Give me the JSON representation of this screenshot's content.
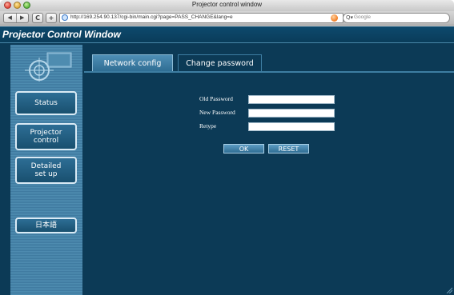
{
  "window": {
    "title": "Projector control window"
  },
  "toolbar": {
    "back_icon": "back-arrow-icon",
    "forward_icon": "forward-arrow-icon",
    "reload_label": "C",
    "add_label": "+",
    "url": "http://169.254.90.137/cgi-bin/main.cgi?page=PASS_CHANGE&lang=e",
    "search_placeholder": "Google"
  },
  "app": {
    "title": "Projector Control Window"
  },
  "sidebar": {
    "items": [
      {
        "label": "Status"
      },
      {
        "label_line1": "Projector",
        "label_line2": "control"
      },
      {
        "label_line1": "Detailed",
        "label_line2": "set up"
      },
      {
        "label": "日本語"
      }
    ]
  },
  "tabs": [
    {
      "label": "Network config",
      "active": false
    },
    {
      "label": "Change password",
      "active": true
    }
  ],
  "form": {
    "old_password_label": "Old Password",
    "new_password_label": "New Password",
    "retype_label": "Retype",
    "ok_label": "OK",
    "reset_label": "RESET"
  },
  "colors": {
    "page_bg": "#0c3a56",
    "sidebar_bg": "#4e8cb0",
    "tab_inactive": "#4f8fb6",
    "button_border": "#d9eaf5"
  }
}
